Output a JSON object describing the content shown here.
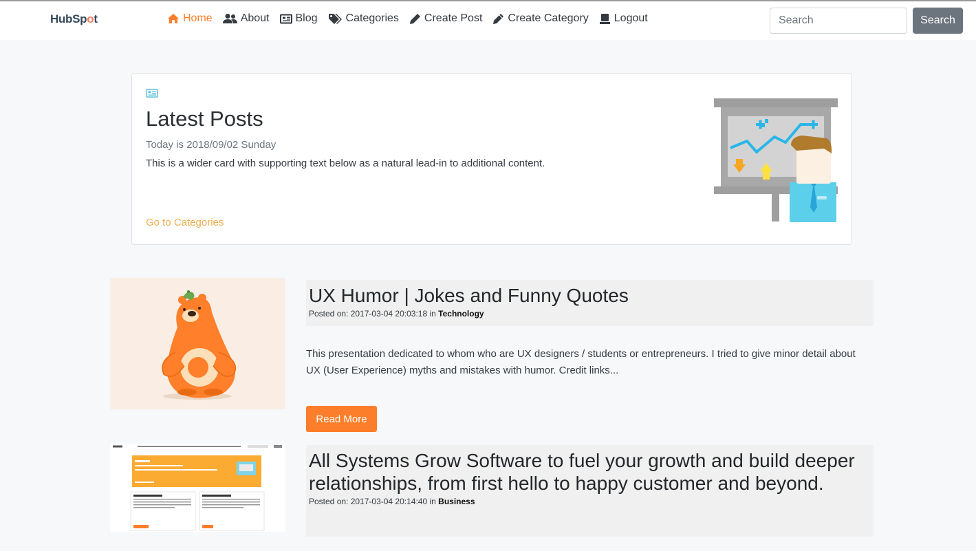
{
  "nav": {
    "brand_a": "HubSp",
    "brand_b": "o",
    "brand_c": "t",
    "items": [
      {
        "label": "Home",
        "icon": "home-icon",
        "active": true
      },
      {
        "label": "About",
        "icon": "users-icon"
      },
      {
        "label": "Blog",
        "icon": "newspaper-icon"
      },
      {
        "label": "Categories",
        "icon": "tags-icon"
      },
      {
        "label": "Create Post",
        "icon": "pen-icon"
      },
      {
        "label": "Create Category",
        "icon": "pencil-icon"
      },
      {
        "label": "Logout",
        "icon": "user-tie-icon"
      }
    ],
    "search_placeholder": "Search",
    "search_button": "Search"
  },
  "hero": {
    "title": "Latest Posts",
    "date_text": "Today is 2018/09/02 Sunday",
    "text": "This is a wider card with supporting text below as a natural lead-in to additional content.",
    "link": "Go to Categories"
  },
  "posts": [
    {
      "title": "UX Humor | Jokes and Funny Quotes",
      "meta_prefix": "Posted on: 2017-03-04 20:03:18 in",
      "category": "Technology",
      "excerpt": "This presentation dedicated to whom who are UX designers / students or entrepreneurs. I tried to give minor detail about UX (User Experience) myths and mistakes with humor. Credit links...",
      "read_more": "Read More"
    },
    {
      "title": "All Systems Grow Software to fuel your growth and build deeper relationships, from first hello to happy customer and beyond.",
      "meta_prefix": "Posted on: 2017-03-04 20:14:40 in",
      "category": "Business"
    }
  ],
  "colors": {
    "accent": "#fd7e2a",
    "link": "#f0ad4e",
    "search_btn": "#6c757d"
  }
}
